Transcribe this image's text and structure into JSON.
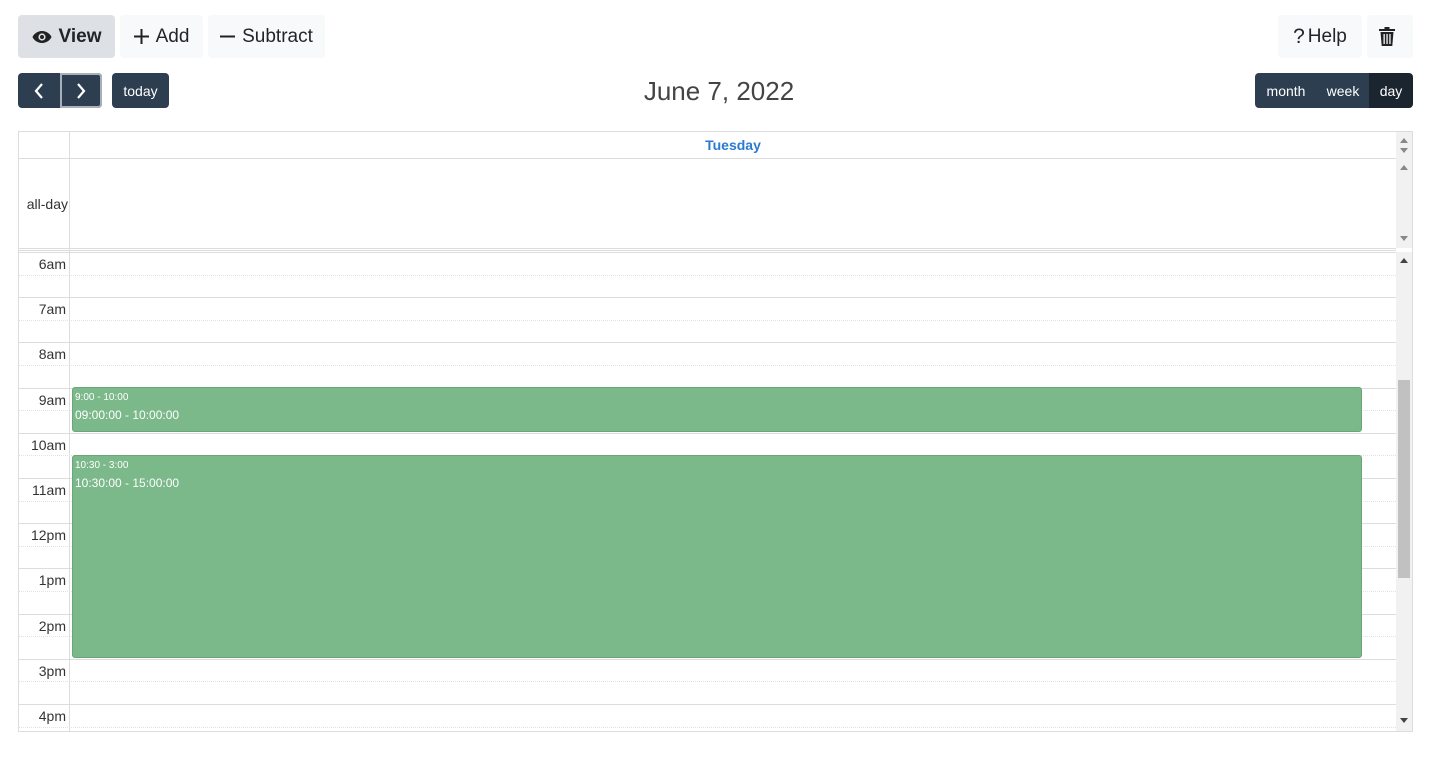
{
  "toolbar": {
    "view_label": "View",
    "add_label": "Add",
    "subtract_label": "Subtract",
    "help_label": "Help",
    "help_icon": "question-icon",
    "delete_icon": "trash-icon"
  },
  "nav": {
    "prev_icon": "chevron-left-icon",
    "next_icon": "chevron-right-icon",
    "today_label": "today"
  },
  "title": "June 7, 2022",
  "views": {
    "month": "month",
    "week": "week",
    "day": "day",
    "active": "day"
  },
  "calendar": {
    "day_header": "Tuesday",
    "allday_label": "all-day",
    "hours": [
      "6am",
      "7am",
      "8am",
      "9am",
      "10am",
      "11am",
      "12pm",
      "1pm",
      "2pm",
      "3pm",
      "4pm"
    ],
    "events": [
      {
        "time": "9:00 - 10:00",
        "title": "09:00:00 - 10:00:00"
      },
      {
        "time": "10:30 - 3:00",
        "title": "10:30:00 - 15:00:00"
      }
    ]
  },
  "colors": {
    "dark": "#2c3e50",
    "event": "#7bb88a",
    "today_header": "#2a7ad2"
  }
}
